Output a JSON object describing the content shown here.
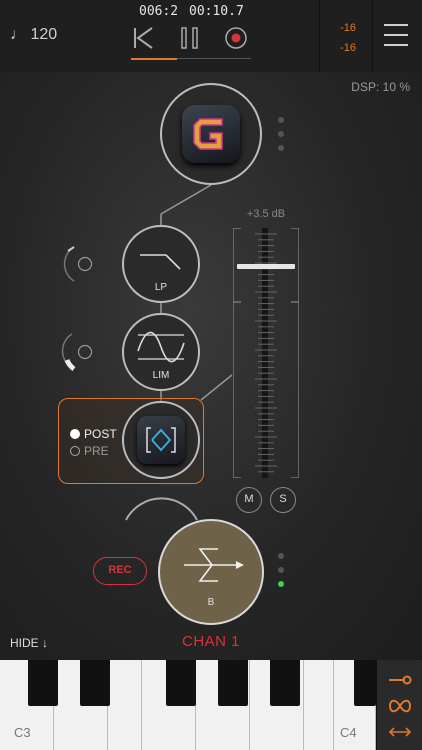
{
  "topbar": {
    "tempo": "♩ 120",
    "bar_beat": "006:2",
    "time": "00:10.7",
    "meter_left": "-16",
    "meter_right": "-16",
    "progress": 0.38
  },
  "dsp": "DSP: 10 %",
  "colors": {
    "accent": "#e0782f",
    "record": "#d8333a",
    "active_dot": "#3fd14a",
    "bus_fill": "#6e6248"
  },
  "chain": {
    "instrument": {
      "icon": "app-logo-g-icon"
    },
    "effects": [
      {
        "label": "LP",
        "icon": "lowpass-filter-icon"
      },
      {
        "label": "LIM",
        "icon": "limiter-icon"
      },
      {
        "label": "",
        "icon": "eq-plugin-icon"
      }
    ],
    "post": {
      "post_label": "POST",
      "pre_label": "PRE",
      "selected": "POST"
    }
  },
  "fader": {
    "gain": "+3.5 dB",
    "mute": "M",
    "solo": "S"
  },
  "bus": {
    "label": "B",
    "rec": "REC"
  },
  "channel_name": "CHAN 1",
  "hide": "HIDE ↓",
  "keyboard": {
    "left_octave": "C3",
    "right_octave": "C4"
  }
}
